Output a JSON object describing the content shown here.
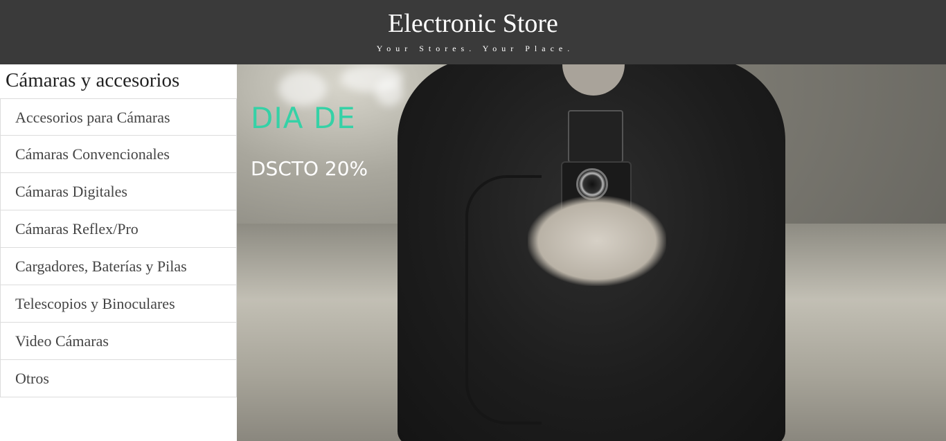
{
  "header": {
    "title": "Electronic Store",
    "tagline": "Your Stores. Your Place."
  },
  "sidebar": {
    "title": "Cámaras y accesorios",
    "items": [
      {
        "label": "Accesorios para Cámaras"
      },
      {
        "label": "Cámaras Convencionales"
      },
      {
        "label": "Cámaras Digitales"
      },
      {
        "label": "Cámaras Reflex/Pro"
      },
      {
        "label": "Cargadores, Baterías y Pilas"
      },
      {
        "label": "Telescopios y Binoculares"
      },
      {
        "label": "Video Cámaras"
      },
      {
        "label": "Otros"
      }
    ]
  },
  "hero": {
    "promo_title": "DIA DE",
    "promo_subtitle": "DSCTO 20%",
    "promo_title_color": "#35d1a6"
  },
  "colors": {
    "header_bg": "#3a3a3a",
    "border": "#dcdcdc"
  }
}
